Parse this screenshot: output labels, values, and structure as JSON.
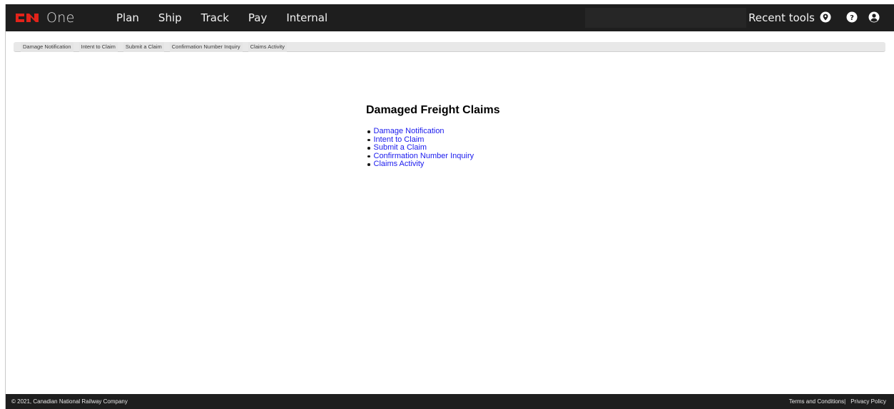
{
  "header": {
    "logo_text": "One",
    "nav": [
      "Plan",
      "Ship",
      "Track",
      "Pay",
      "Internal"
    ],
    "recent_tools": "Recent tools",
    "icons": [
      "location-icon",
      "help-icon",
      "user-icon"
    ],
    "brand_color": "#e2231a",
    "bg_color": "#1e1e1e"
  },
  "tabs": [
    "Damage Notification",
    "Intent to Claim",
    "Submit a Claim",
    "Confirmation Number Inquiry",
    "Claims Activity"
  ],
  "main": {
    "title": "Damaged Freight Claims",
    "links": [
      "Damage Notification",
      "Intent to Claim",
      "Submit a Claim",
      "Confirmation Number Inquiry",
      "Claims Activity"
    ],
    "link_color": "#1a1aee"
  },
  "footer": {
    "copyright": "© 2021, Canadian National Railway Company",
    "terms": "Terms and Conditions",
    "separator": "|",
    "privacy": "Privacy Policy"
  }
}
